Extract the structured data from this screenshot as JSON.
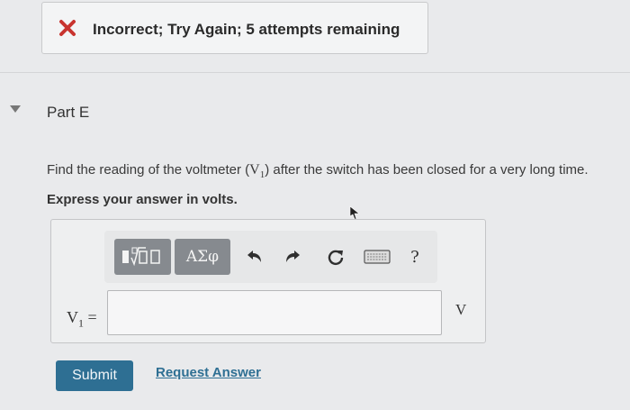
{
  "feedback": {
    "message": "Incorrect; Try Again; 5 attempts remaining",
    "icon": "x-icon",
    "color": "#c8342f"
  },
  "part": {
    "title": "Part E",
    "expanded": true
  },
  "question": {
    "prompt_before": "Find the reading of the voltmeter (",
    "prompt_var": "V",
    "prompt_sub": "1",
    "prompt_after": ") after the switch has been closed for a very long time.",
    "instruction": "Express your answer in volts."
  },
  "toolbar": {
    "template_icon": "templates-icon",
    "greek_label": "ΑΣφ",
    "undo_icon": "undo-icon",
    "redo_icon": "redo-icon",
    "reset_icon": "reset-icon",
    "keyboard_icon": "keyboard-icon",
    "help_label": "?"
  },
  "answer": {
    "var": "V",
    "sub": "1",
    "equals": " =",
    "value": "",
    "unit": "V"
  },
  "actions": {
    "submit_label": "Submit",
    "request_label": "Request Answer"
  },
  "colors": {
    "accent": "#2e6f93",
    "error": "#c8342f"
  }
}
